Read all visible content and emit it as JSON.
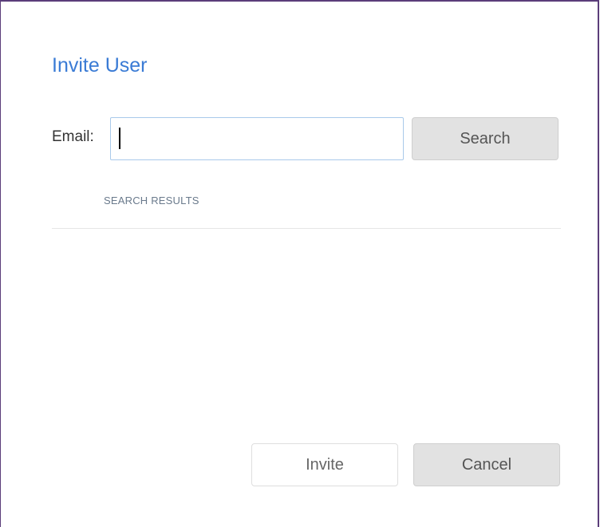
{
  "dialog": {
    "title": "Invite User",
    "email": {
      "label": "Email:",
      "value": "",
      "placeholder": ""
    },
    "search_label": "Search",
    "results_heading": "SEARCH RESULTS",
    "results": [],
    "invite_label": "Invite",
    "cancel_label": "Cancel"
  },
  "colors": {
    "title": "#3a7bd5",
    "border": "#5b3d7a",
    "input_border": "#a9c9ea",
    "button_gray": "#e2e2e2"
  }
}
